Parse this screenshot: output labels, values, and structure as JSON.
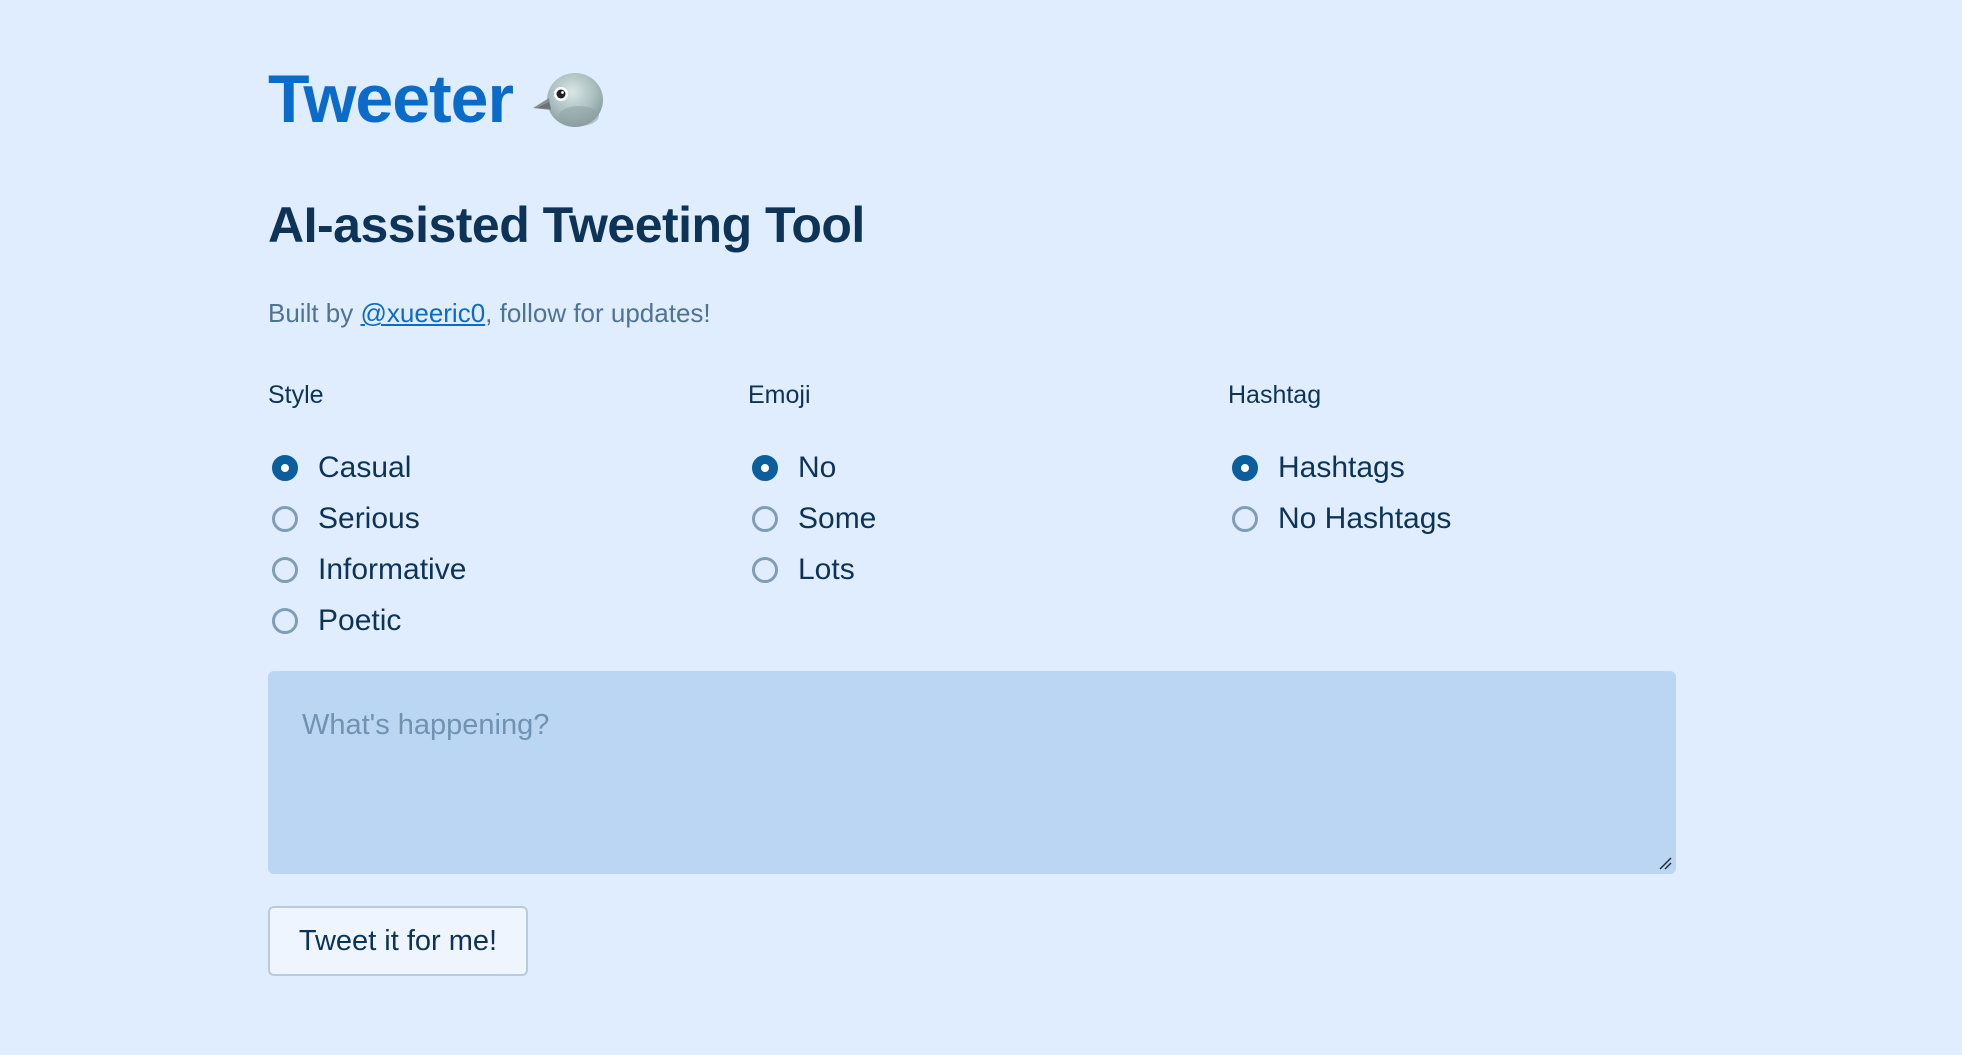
{
  "app": {
    "title": "Tweeter",
    "subtitle": "AI-assisted Tweeting Tool",
    "byline_prefix": "Built by ",
    "byline_link": "@xueeric0",
    "byline_suffix": ", follow for updates!"
  },
  "style_group": {
    "label": "Style",
    "options": [
      "Casual",
      "Serious",
      "Informative",
      "Poetic"
    ],
    "selected": "Casual"
  },
  "emoji_group": {
    "label": "Emoji",
    "options": [
      "No",
      "Some",
      "Lots"
    ],
    "selected": "No"
  },
  "hashtag_group": {
    "label": "Hashtag",
    "options": [
      "Hashtags",
      "No Hashtags"
    ],
    "selected": "Hashtags"
  },
  "tweet_input": {
    "placeholder": "What's happening?",
    "value": ""
  },
  "submit": {
    "label": "Tweet it for me!"
  },
  "colors": {
    "background": "#e0edfe",
    "title": "#0b6bc9",
    "text": "#0d3357",
    "radio_checked": "#0b5e9e",
    "input_bg": "#bad6f2"
  },
  "icons": {
    "title_icon": "bird-icon"
  }
}
